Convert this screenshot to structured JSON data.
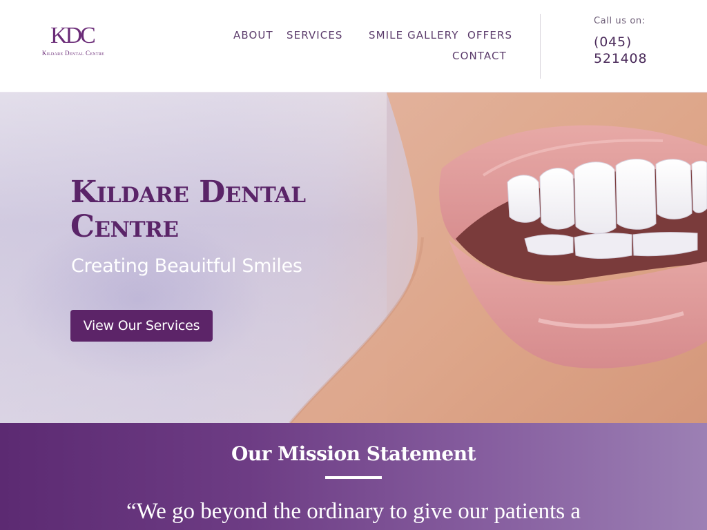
{
  "header": {
    "logo": {
      "mark": "KDC",
      "subtitle": "Kildare Dental Centre"
    },
    "nav": {
      "about": "ABOUT",
      "services": "SERVICES",
      "smile_gallery": "SMILE GALLERY",
      "offers": "OFFERS",
      "contact": "CONTACT"
    },
    "call_label": "Call us on:",
    "phone": "(045) 521408"
  },
  "hero": {
    "title": "Kildare Dental Centre",
    "subtitle": "Creating Beauitful Smiles",
    "cta_label": "View Our Services"
  },
  "mission": {
    "title": "Our Mission Statement",
    "quote": "“We go beyond the ordinary to give our patients a"
  },
  "colors": {
    "brand_purple": "#5c2468",
    "mission_gradient_start": "#5c2a72",
    "mission_gradient_end": "#9c80b4"
  },
  "icons": [
    "logo-monogram"
  ]
}
